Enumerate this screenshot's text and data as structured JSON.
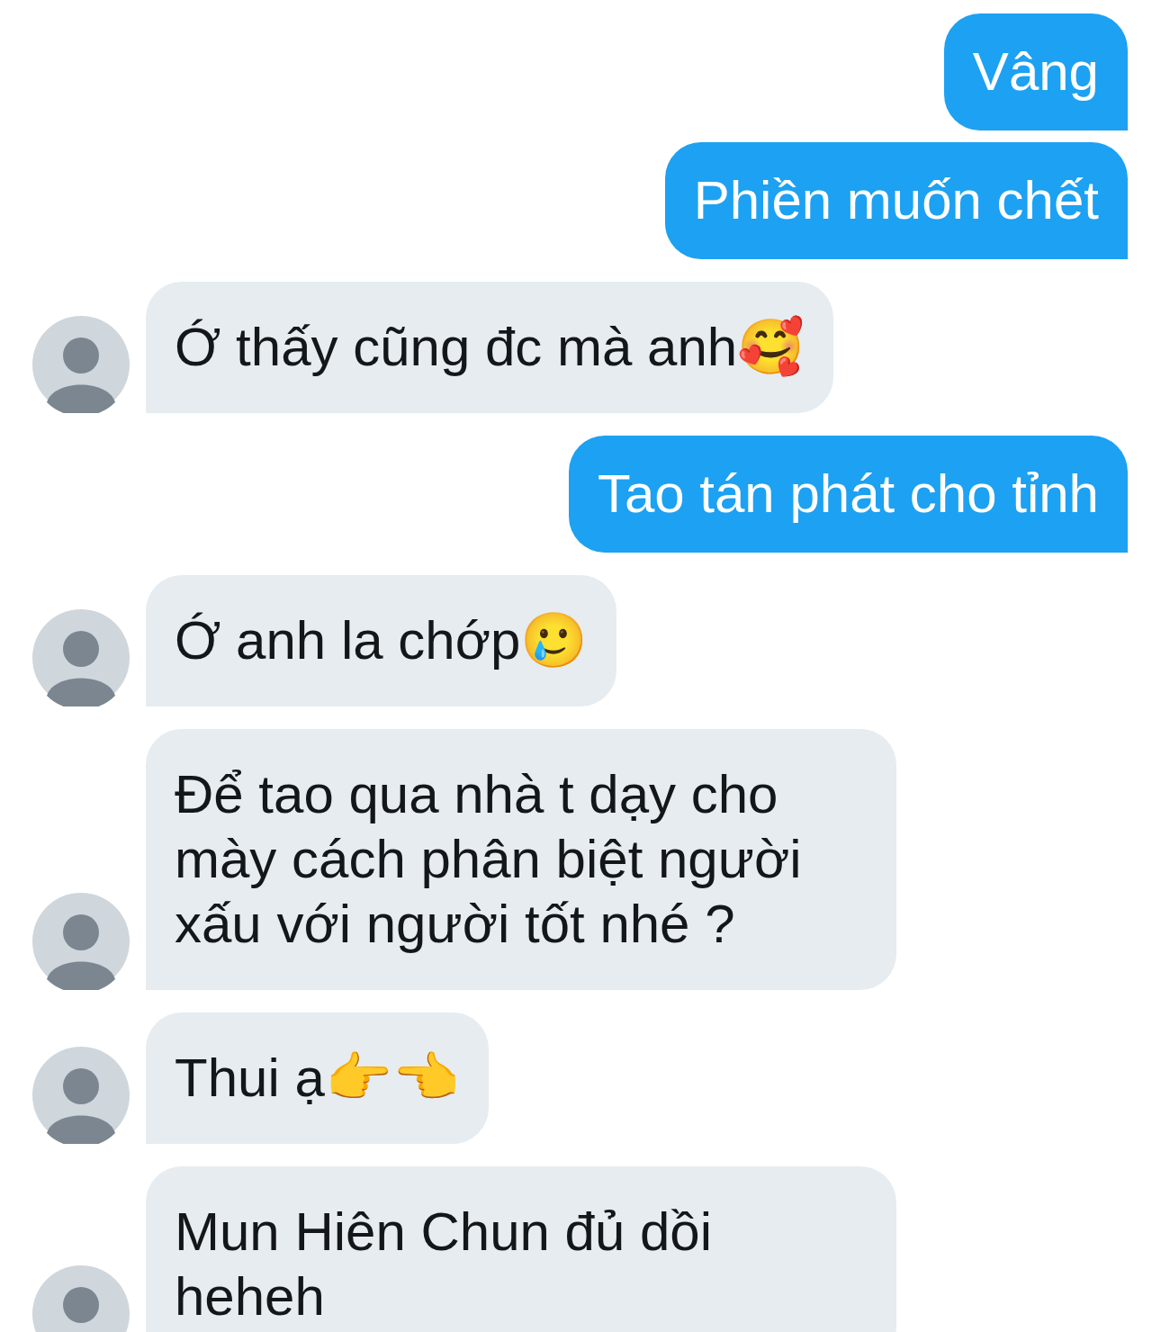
{
  "messages": [
    {
      "kind": "outgoing",
      "text": "Vâng"
    },
    {
      "kind": "outgoing",
      "text": "Phiền muốn chết"
    },
    {
      "kind": "incoming",
      "text": "Ớ thấy cũng đc mà anh🥰"
    },
    {
      "kind": "outgoing",
      "text": "Tao tán phát cho tỉnh"
    },
    {
      "kind": "incoming",
      "text": "Ớ anh la chớp🥲"
    },
    {
      "kind": "incoming",
      "text": "Để tao qua nhà t dạy cho mày cách phân biệt người xấu với người tốt nhé ?"
    },
    {
      "kind": "incoming",
      "text": "Thui ạ👉👈"
    },
    {
      "kind": "incoming",
      "text": "Mun Hiên Chun đủ dồi heheh"
    }
  ]
}
